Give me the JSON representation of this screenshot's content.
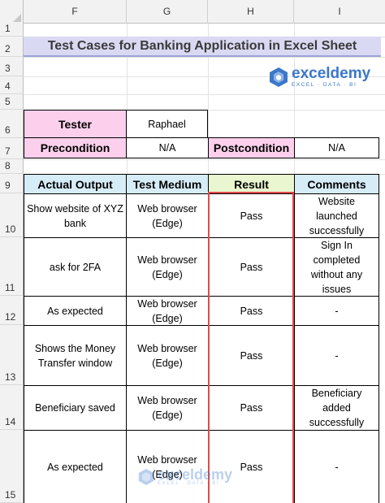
{
  "columns": [
    "F",
    "G",
    "H",
    "I"
  ],
  "rows": [
    "1",
    "2",
    "3",
    "4",
    "5",
    "6",
    "7",
    "8",
    "9",
    "10",
    "11",
    "12",
    "13",
    "14",
    "15"
  ],
  "title": "Test Cases for Banking Application in Excel Sheet",
  "logo": {
    "name": "exceldemy",
    "tagline": "EXCEL · DATA · BI",
    "icon": "exceldemy-logo-icon"
  },
  "info": {
    "tester_label": "Tester",
    "tester_value": "Raphael",
    "precondition_label": "Precondition",
    "precondition_value": "N/A",
    "postcondition_label": "Postcondition",
    "postcondition_value": "N/A"
  },
  "table": {
    "headers": [
      "Actual Output",
      "Test Medium",
      "Result",
      "Comments"
    ],
    "rows": [
      {
        "output": "Show website of XYZ bank",
        "medium": "Web browser (Edge)",
        "result": "Pass",
        "comment": "Website launched successfully"
      },
      {
        "output": "ask for 2FA",
        "medium": "Web browser (Edge)",
        "result": "Pass",
        "comment": "Sign In completed without any issues"
      },
      {
        "output": "As expected",
        "medium": "Web browser (Edge)",
        "result": "Pass",
        "comment": "-"
      },
      {
        "output": "Shows the Money Transfer window",
        "medium": "Web browser (Edge)",
        "result": "Pass",
        "comment": "-"
      },
      {
        "output": "Beneficiary saved",
        "medium": "Web browser (Edge)",
        "result": "Pass",
        "comment": "Beneficiary added successfully"
      },
      {
        "output": "As expected",
        "medium": "Web browser (Edge)",
        "result": "Pass",
        "comment": "-"
      }
    ]
  },
  "colors": {
    "title_bg": "#d9d9f3",
    "label_pink": "#fcd0ec",
    "header_blue": "#d6ecf7",
    "header_green": "#e9f6cf",
    "result_outline": "#e24a4a"
  }
}
